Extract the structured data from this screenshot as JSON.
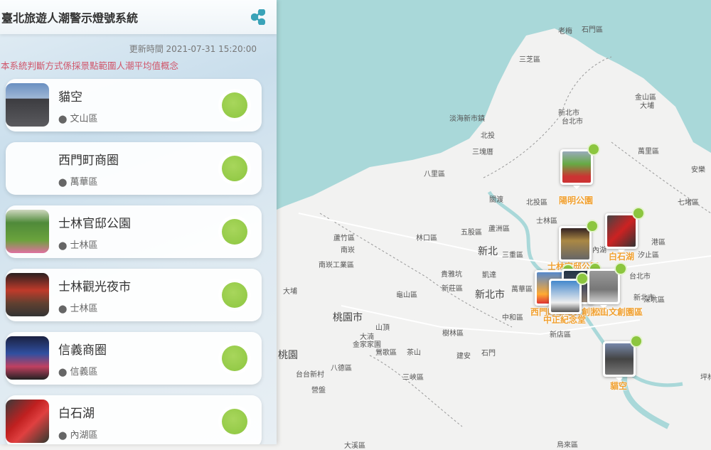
{
  "header": {
    "title": "臺北旅遊人潮警示燈號系統",
    "share_icon": "share-icon"
  },
  "updated": "更新時間 2021-07-31 15:20:00",
  "note": "本系統判斷方式係採景點範圍人潮平均值概念",
  "colors": {
    "green_light": "#8cc63f",
    "note": "#d0556a",
    "marker_label": "#f0a030",
    "sea": "#a9d8d9"
  },
  "spots": [
    {
      "name": "貓空",
      "district": "文山區",
      "status": "green"
    },
    {
      "name": "西門町商圈",
      "district": "萬華區",
      "status": "green"
    },
    {
      "name": "士林官邸公園",
      "district": "士林區",
      "status": "green"
    },
    {
      "name": "士林觀光夜市",
      "district": "士林區",
      "status": "green"
    },
    {
      "name": "信義商圈",
      "district": "信義區",
      "status": "green"
    },
    {
      "name": "白石湖",
      "district": "內湖區",
      "status": "green"
    }
  ],
  "map": {
    "labels": [
      "老梅",
      "石門區",
      "三芝區",
      "金山區",
      "大埔",
      "淡海新市鎮",
      "北投",
      "三塊厝",
      "八里區",
      "關渡",
      "新北市",
      "台北市",
      "萬里區",
      "安樂",
      "七堵區",
      "北投區",
      "士林區",
      "蘆竹區",
      "南崁",
      "林口區",
      "五股區",
      "蘆洲區",
      "三重區",
      "港區",
      "汐止區",
      "南崁工業區",
      "貴雅坑",
      "凱達",
      "龜山區",
      "新莊區",
      "萬華區",
      "台北市",
      "中和區",
      "大湳",
      "山頂",
      "樹林區",
      "金家家園",
      "鶯歌區",
      "茶山",
      "建安",
      "石門",
      "新店區",
      "八德區",
      "三峽區",
      "坪林",
      "台台新村",
      "營盤",
      "大溪區",
      "烏來區",
      "深坑區",
      "內湖",
      "新北市",
      "大埔"
    ],
    "big_labels": [
      "新北",
      "新北市",
      "桃園市",
      "桃園"
    ],
    "markers": [
      "陽明公園",
      "白石湖",
      "士林官邸公園",
      "西門町",
      "華山文創園區",
      "松山文創園區",
      "中正紀念堂",
      "貓空"
    ]
  }
}
